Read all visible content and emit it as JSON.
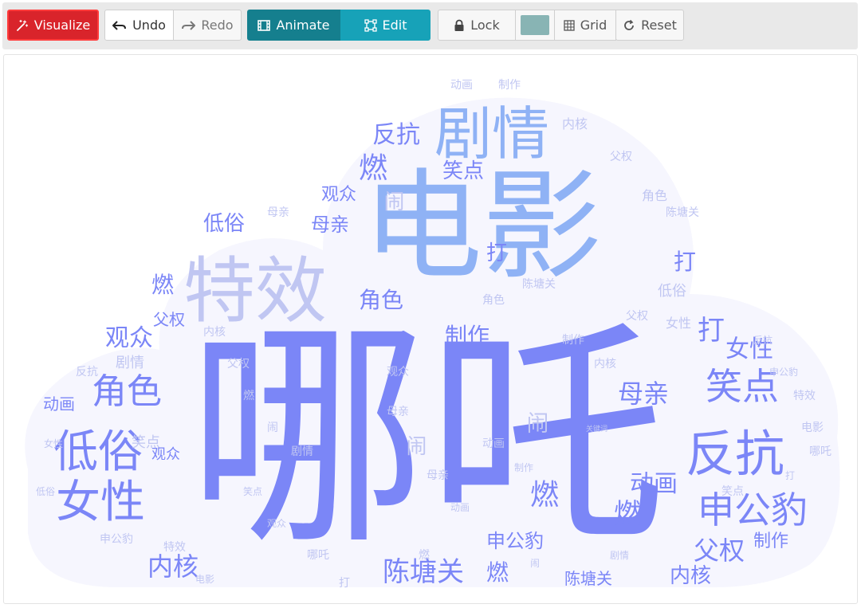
{
  "toolbar": {
    "visualize_label": "Visualize",
    "undo_label": "Undo",
    "redo_label": "Redo",
    "animate_label": "Animate",
    "edit_label": "Edit",
    "lock_label": "Lock",
    "grid_label": "Grid",
    "reset_label": "Reset",
    "color_swatch": "#88b4b4"
  },
  "colors": {
    "big": "#7b86f7",
    "mid": "#8fb2f5",
    "light": "#c0c6f2",
    "cloud": "#f6f6fe"
  },
  "wordcloud": {
    "words": [
      {
        "text": "哪吒",
        "weight": 100,
        "tone": "big"
      },
      {
        "text": "电影",
        "weight": 58,
        "tone": "mid"
      },
      {
        "text": "特效",
        "weight": 36,
        "tone": "light"
      },
      {
        "text": "剧情",
        "weight": 28,
        "tone": "mid"
      },
      {
        "text": "反抗",
        "weight": 24,
        "tone": "big"
      },
      {
        "text": "低俗",
        "weight": 22,
        "tone": "big"
      },
      {
        "text": "女性",
        "weight": 22,
        "tone": "big"
      },
      {
        "text": "申公豹",
        "weight": 20,
        "tone": "big"
      },
      {
        "text": "笑点",
        "weight": 20,
        "tone": "big"
      },
      {
        "text": "角色",
        "weight": 18,
        "tone": "big"
      },
      {
        "text": "陈塘关",
        "weight": 17,
        "tone": "big"
      },
      {
        "text": "母亲",
        "weight": 15,
        "tone": "big"
      },
      {
        "text": "观众",
        "weight": 14,
        "tone": "big"
      },
      {
        "text": "动画",
        "weight": 14,
        "tone": "big"
      },
      {
        "text": "父权",
        "weight": 13,
        "tone": "big"
      },
      {
        "text": "内核",
        "weight": 13,
        "tone": "big"
      },
      {
        "text": "制作",
        "weight": 13,
        "tone": "big"
      },
      {
        "text": "燃",
        "weight": 12,
        "tone": "big"
      },
      {
        "text": "闹",
        "weight": 12,
        "tone": "light"
      },
      {
        "text": "打",
        "weight": 11,
        "tone": "big"
      },
      {
        "text": "关键词",
        "weight": 3,
        "tone": "light"
      }
    ]
  }
}
